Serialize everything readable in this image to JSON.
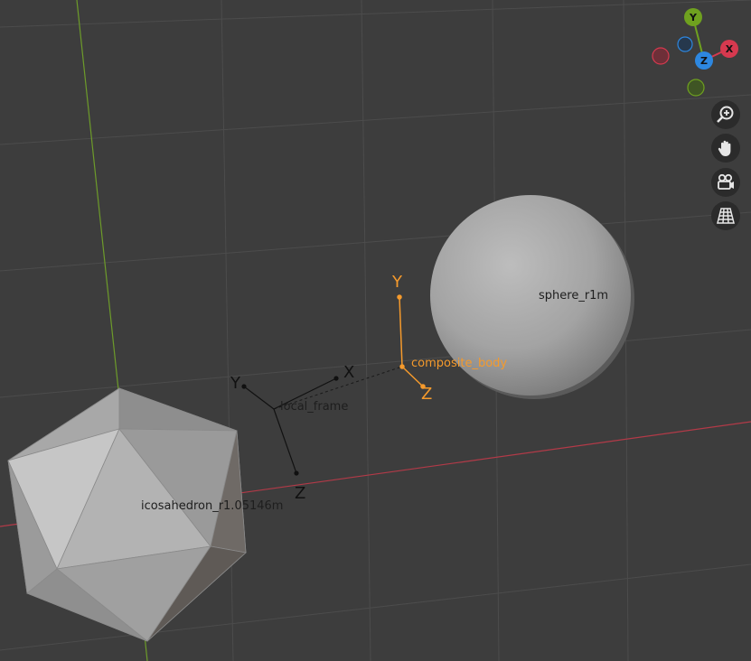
{
  "colors": {
    "background": "#3d3d3d",
    "grid": "#4f4f4f",
    "x_axis": "#b33a48",
    "y_axis": "#6d9b2a",
    "selected": "#f59a2c",
    "empty_unselected": "#111111",
    "gizmo_x": "#d6394f",
    "gizmo_y": "#6fa11f",
    "gizmo_z": "#2d87e0",
    "nav_button_bg": "#2b2b2b"
  },
  "viewport": {
    "objects": {
      "sphere_label": "sphere_r1m",
      "icosahedron_label": "icosahedron_r1.05146m",
      "composite_label": "composite_body",
      "local_frame_label": "local_frame"
    },
    "composite_axes": {
      "x": "",
      "y": "Y",
      "z": "Z"
    },
    "local_frame_axes": {
      "x": "X",
      "y": "Y",
      "z": "Z"
    }
  },
  "gizmo": {
    "x_label": "X",
    "y_label": "Y",
    "z_label": "Z"
  },
  "nav_buttons": [
    {
      "icon": "zoom-icon",
      "tooltip": ""
    },
    {
      "icon": "hand-pan-icon",
      "tooltip": ""
    },
    {
      "icon": "camera-icon",
      "tooltip": ""
    },
    {
      "icon": "grid-ortho-icon",
      "tooltip": ""
    }
  ]
}
